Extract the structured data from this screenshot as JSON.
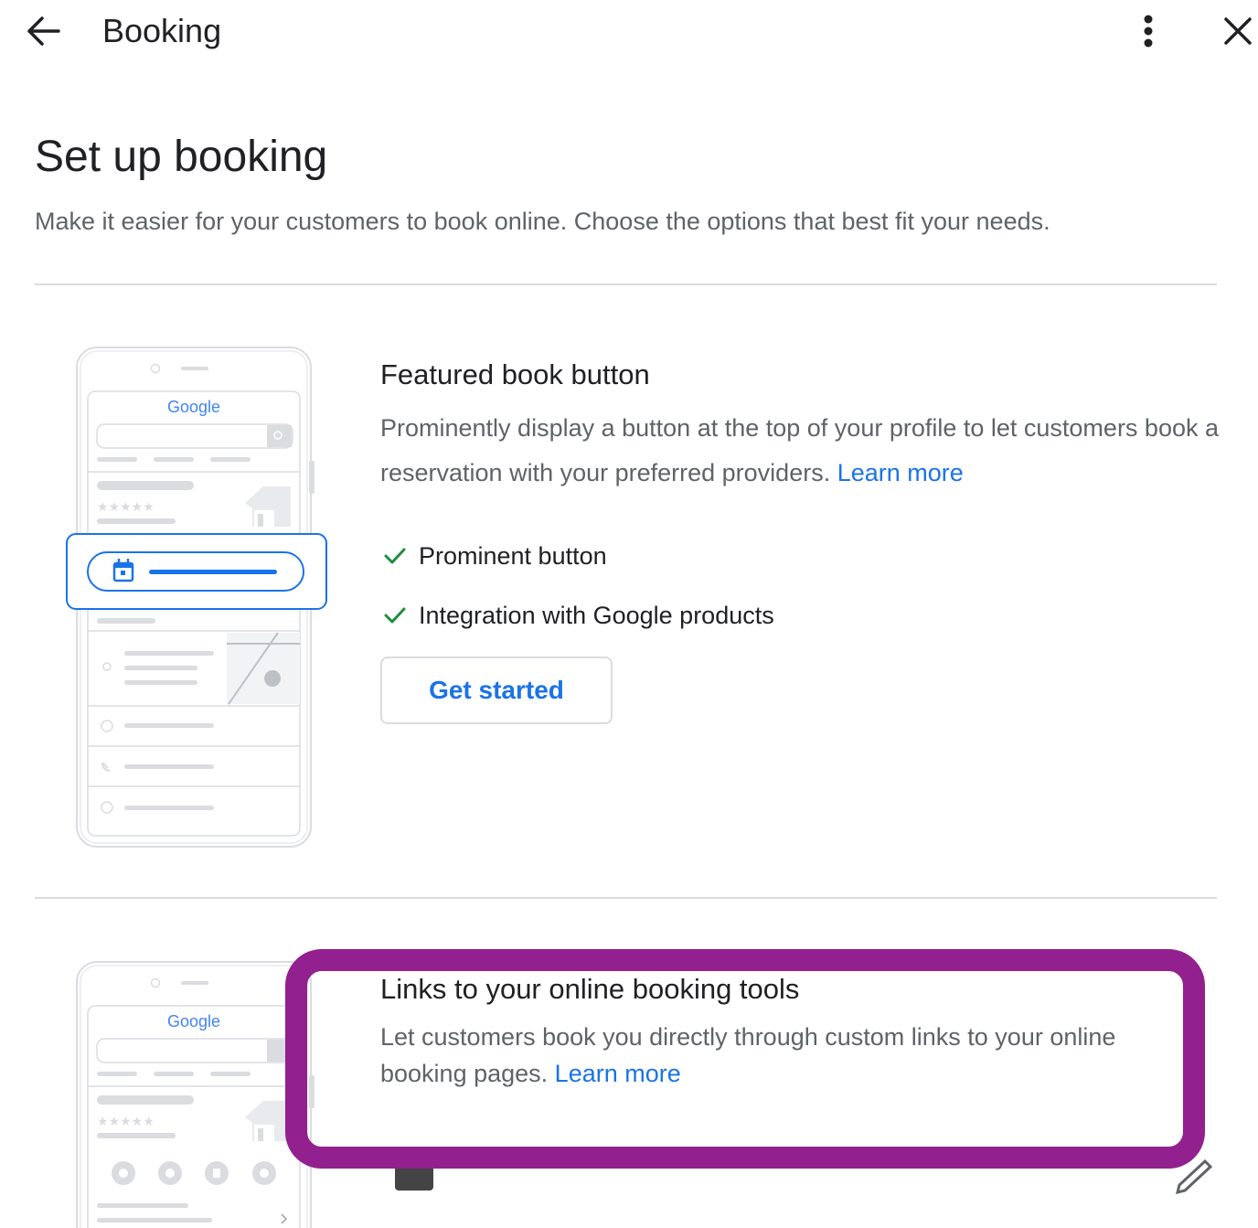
{
  "topbar": {
    "title": "Booking",
    "back_icon": "arrow-back-icon",
    "more_icon": "more-vert-icon",
    "close_icon": "close-icon"
  },
  "header": {
    "title": "Set up booking",
    "subtitle": "Make it easier for your customers to book online. Choose the options that best fit your needs."
  },
  "featured": {
    "illustration_logo": "Google",
    "title": "Featured book button",
    "description": "Prominently display a button at the top of your profile to let customers book a reservation with your preferred providers.",
    "learn_more": "Learn more",
    "features": [
      "Prominent button",
      "Integration with Google products"
    ],
    "cta": "Get started"
  },
  "links": {
    "illustration_logo": "Google",
    "title": "Links to your online booking tools",
    "description": "Let customers book you directly through custom links to your online booking pages.",
    "learn_more": "Learn more"
  },
  "colors": {
    "accent": "#1a73e8",
    "check": "#1e8e3e",
    "highlight": "#92208f",
    "divider": "#dadce0"
  }
}
